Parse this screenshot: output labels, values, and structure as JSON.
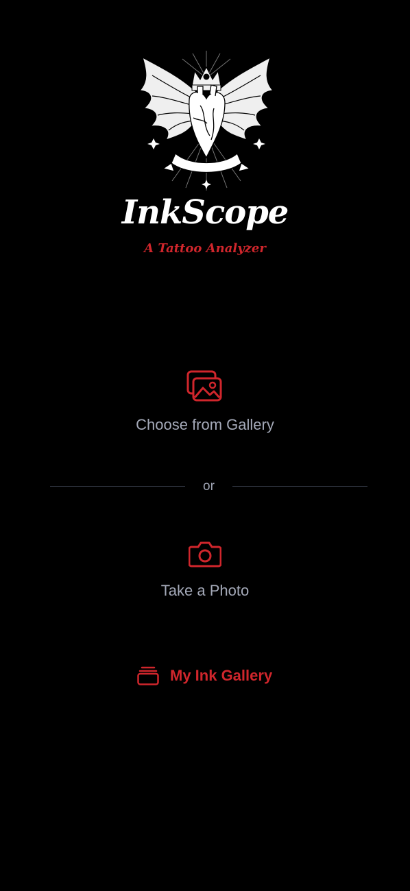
{
  "app": {
    "title": "InkScope",
    "subtitle": "A Tattoo Analyzer"
  },
  "actions": {
    "gallery_label": "Choose from Gallery",
    "divider_text": "or",
    "photo_label": "Take a Photo",
    "ink_gallery_label": "My Ink Gallery"
  },
  "icons": {
    "logo": "winged-heart-crown-emblem",
    "gallery": "photo-stack-icon",
    "camera": "camera-icon",
    "ink_gallery": "card-stack-icon"
  },
  "colors": {
    "background": "#000000",
    "accent": "#d0262c",
    "label": "#a4a9b8",
    "divider": "#3a3f4d",
    "title": "#ffffff"
  }
}
